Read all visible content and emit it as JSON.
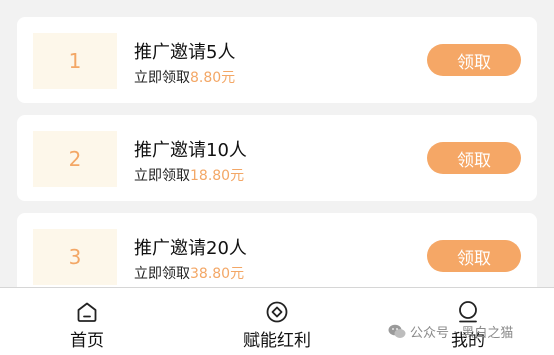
{
  "rewards": [
    {
      "rank": "1",
      "title": "推广邀请5人",
      "claim_prefix": "立即领取",
      "amount": "8.80元",
      "button": "领取"
    },
    {
      "rank": "2",
      "title": "推广邀请10人",
      "claim_prefix": "立即领取",
      "amount": "18.80元",
      "button": "领取"
    },
    {
      "rank": "3",
      "title": "推广邀请20人",
      "claim_prefix": "立即领取",
      "amount": "38.80元",
      "button": "领取"
    }
  ],
  "tabbar": {
    "items": [
      {
        "label": "首页",
        "icon": "home-icon"
      },
      {
        "label": "赋能红利",
        "icon": "coin-icon"
      },
      {
        "label": "我的",
        "icon": "user-icon"
      }
    ]
  },
  "watermark": {
    "text": "公众号 · 黑白之猫"
  },
  "colors": {
    "accent": "#f5a766",
    "rank_bg": "#fdf7ea",
    "page_bg": "#f2f2f2"
  }
}
